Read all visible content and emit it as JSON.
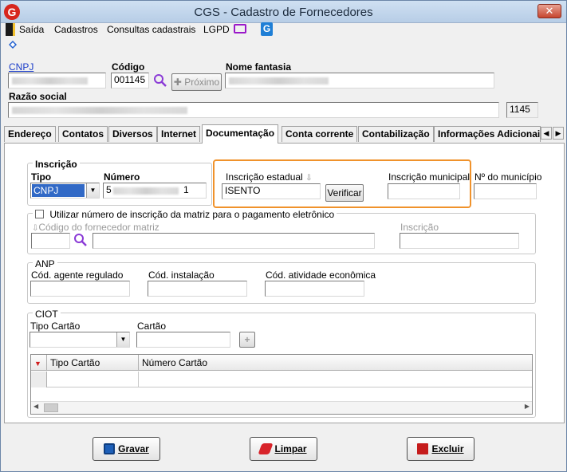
{
  "window": {
    "title": "CGS - Cadastro de Fornecedores",
    "close_glyph": "✕",
    "app_logo_glyph": "G"
  },
  "menu": {
    "items": [
      "Saída",
      "Cadastros",
      "Consultas cadastrais",
      "LGPD"
    ],
    "g_icon_glyph": "G"
  },
  "header": {
    "cnpj_label": "CNPJ",
    "codigo_label": "Código",
    "codigo_value": "001145",
    "proximo_label": "Próximo",
    "nome_fantasia_label": "Nome fantasia",
    "razao_social_label": "Razão social",
    "id_value": "1145"
  },
  "tabs": [
    "Endereço",
    "Contatos",
    "Diversos",
    "Internet",
    "Documentação",
    "Conta corrente",
    "Contabilização",
    "Informações Adicionai"
  ],
  "tab_arrows": {
    "left": "◀",
    "right": "▶"
  },
  "inscricao": {
    "group_title": "Inscrição",
    "tipo_label": "Tipo",
    "tipo_value": "CNPJ",
    "numero_label": "Número",
    "numero_prefix": "5",
    "numero_suffix": "1",
    "estadual_label": "Inscrição estadual",
    "estadual_value": "ISENTO",
    "verificar_label": "Verificar",
    "municipal_label": "Inscrição municipal",
    "num_municipio_label": "Nº do município"
  },
  "matriz": {
    "checkbox_label": "Utilizar número de inscrição da matriz para o pagamento eletrônico",
    "codigo_label": "Código do fornecedor matriz",
    "inscricao_label": "Inscrição"
  },
  "anp": {
    "group_title": "ANP",
    "agente_label": "Cód. agente regulado",
    "instalacao_label": "Cód. instalação",
    "atividade_label": "Cód. atividade econômica"
  },
  "ciot": {
    "group_title": "CIOT",
    "tipo_cartao_label": "Tipo Cartão",
    "cartao_label": "Cartão",
    "add_glyph": "+",
    "grid_columns": [
      "Tipo Cartão",
      "Número Cartão"
    ]
  },
  "buttons": {
    "gravar": "Gravar",
    "limpar": "Limpar",
    "excluir": "Excluir"
  },
  "colors": {
    "highlight": "#f0922b",
    "link": "#1a3cc8",
    "title_gradient_top": "#cfe0f2",
    "close_red": "#c6452f"
  },
  "icons": {
    "exit": "exit-door-icon",
    "monitor": "monitor-icon",
    "g_logo": "g-logo-icon",
    "search": "search-icon",
    "down_arrow": "down-arrow-icon",
    "save": "floppy-save-icon",
    "eraser": "eraser-icon",
    "trash": "trash-icon"
  }
}
